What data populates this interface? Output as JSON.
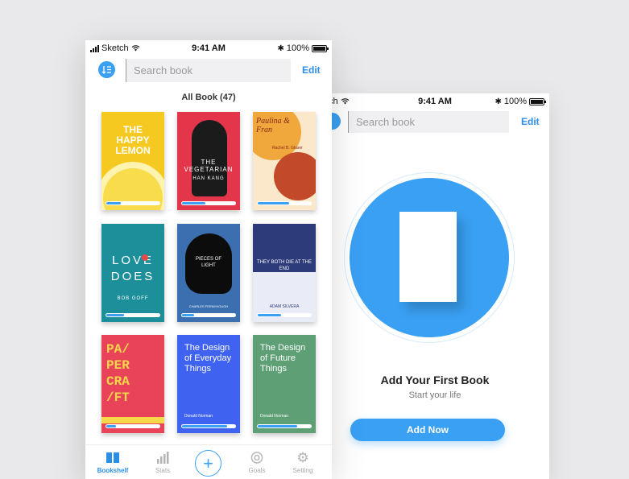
{
  "front": {
    "status": {
      "carrier": "Sketch",
      "time": "9:41 AM",
      "battery": "100%"
    },
    "search_placeholder": "Search book",
    "edit_label": "Edit",
    "section_title": "All Book (47)",
    "books": [
      {
        "title": "THE HAPPY LEMON",
        "progress": 0.3,
        "color": "#f6c921"
      },
      {
        "title": "THE VEGETARIAN",
        "author": "HAN KANG",
        "progress": 0.45,
        "color": "#e3364b"
      },
      {
        "title": "Paulina & Fran",
        "author": "Rachel B. Glaser",
        "progress": 0.6,
        "color": "#f0a73c"
      },
      {
        "title": "LOVE DOES",
        "author": "BOB GOFF",
        "progress": 0.35,
        "color": "#1d8f9a"
      },
      {
        "title": "PIECES OF LIGHT",
        "author": "CHARLES FERNYHOUGH",
        "progress": 0.25,
        "color": "#3b6fb0"
      },
      {
        "title": "THEY BOTH DIE AT THE END",
        "author": "ADAM SILVERA",
        "progress": 0.45,
        "color": "#2e3b7a"
      },
      {
        "title": "PA/ PER CRA /FT",
        "progress": 0.2,
        "color": "#e84359"
      },
      {
        "title": "The Design of Everyday Things",
        "author": "Donald Norman",
        "progress": 0.85,
        "color": "#3f63f0"
      },
      {
        "title": "The Design of Future Things",
        "author": "Donald Norman",
        "progress": 0.75,
        "color": "#5e9f75"
      }
    ],
    "tabs": [
      {
        "label": "Bookshelf",
        "icon": "bookshelf-icon",
        "active": true
      },
      {
        "label": "Stats",
        "icon": "stats-icon"
      },
      {
        "label": "Goals",
        "icon": "goals-icon"
      },
      {
        "label": "Setting",
        "icon": "gear-icon"
      }
    ],
    "accent": "#3aa0f3"
  },
  "back": {
    "status": {
      "carrier": "Sketch",
      "time": "9:41 AM",
      "battery": "100%"
    },
    "search_placeholder": "Search book",
    "edit_label": "Edit",
    "empty_title": "Add Your First Book",
    "empty_subtitle": "Start your life",
    "cta_label": "Add Now"
  }
}
